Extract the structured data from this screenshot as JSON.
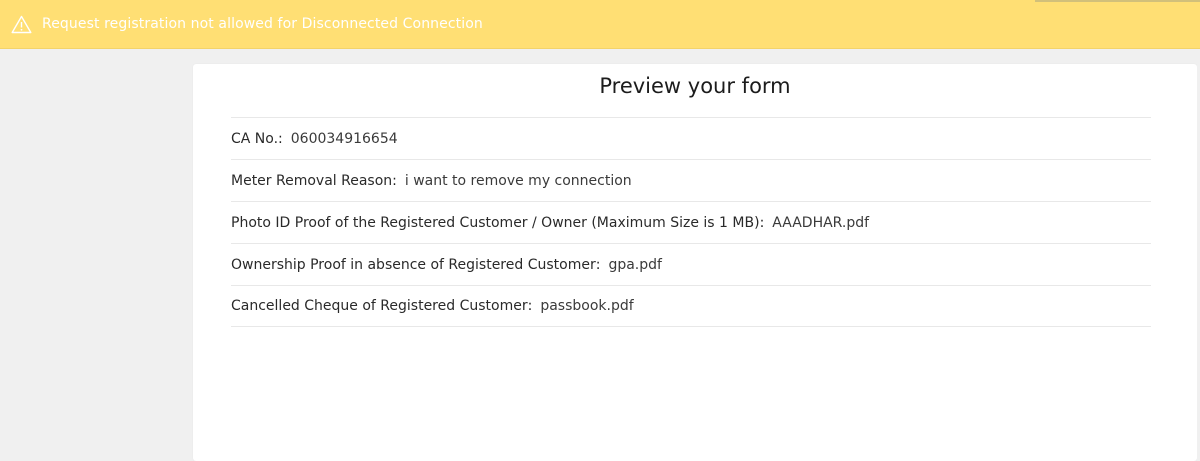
{
  "alert": {
    "icon": "warning-triangle-icon",
    "message": "Request registration not allowed for Disconnected Connection",
    "background_color": "#ffdf74",
    "text_color": "#ffffff"
  },
  "preview": {
    "title": "Preview your form",
    "fields": [
      {
        "label": "CA No.",
        "value": "060034916654"
      },
      {
        "label": "Meter Removal Reason",
        "value": "i want to remove my connection"
      },
      {
        "label": "Photo ID Proof of the Registered Customer / Owner (Maximum Size is 1 MB)",
        "value": "AAADHAR.pdf"
      },
      {
        "label": "Ownership Proof in absence of Registered Customer",
        "value": "gpa.pdf"
      },
      {
        "label": "Cancelled Cheque of Registered Customer",
        "value": "passbook.pdf"
      }
    ]
  }
}
